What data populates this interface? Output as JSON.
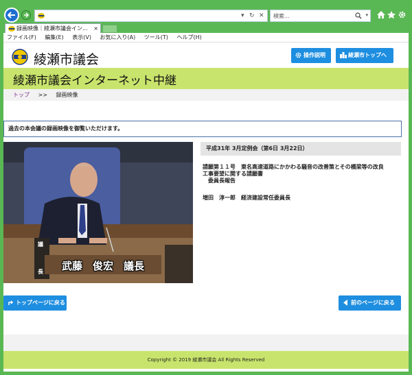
{
  "browser": {
    "address_url": "",
    "search_placeholder": "検索...",
    "tab_title": "録画映像｜綾瀬市議会イン...",
    "menu": [
      "ファイル(F)",
      "編集(E)",
      "表示(V)",
      "お気に入り(A)",
      "ツール(T)",
      "ヘルプ(H)"
    ]
  },
  "header": {
    "logo_text": "綾瀬市議会",
    "btn_help": "操作説明",
    "btn_city_top": "綾瀬市トップへ"
  },
  "banner": {
    "title": "綾瀬市議会インターネット中継"
  },
  "breadcrumb": {
    "top": "トップ",
    "sep": ">>",
    "current": "録画映像"
  },
  "notice": "過去の本会議の録画映像を御覧いただけます。",
  "video": {
    "caption": "武藤　俊宏　議長",
    "podium_label_1": "議",
    "podium_label_2": "長"
  },
  "session": {
    "title": "平成31年 3月定例会（第6日 3月22日）",
    "item_line1": "請願第１１号　東名高速道路にかかわる騒音の改善策とその橋梁等の改良",
    "item_line2": "工事要望に関する請願書",
    "item_line3": "　委員長報告",
    "speaker": "増田　淳一郎　経済建設常任委員長"
  },
  "nav": {
    "back_top": "トップページに戻る",
    "back_prev": "前のページに戻る"
  },
  "footer": {
    "copyright": "Copyright © 2019 綾瀬市議会 All Rights Reserved"
  },
  "colors": {
    "browser_frame": "#5ab854",
    "accent_blue": "#1e8ee0",
    "banner_green": "#c9e46c"
  }
}
